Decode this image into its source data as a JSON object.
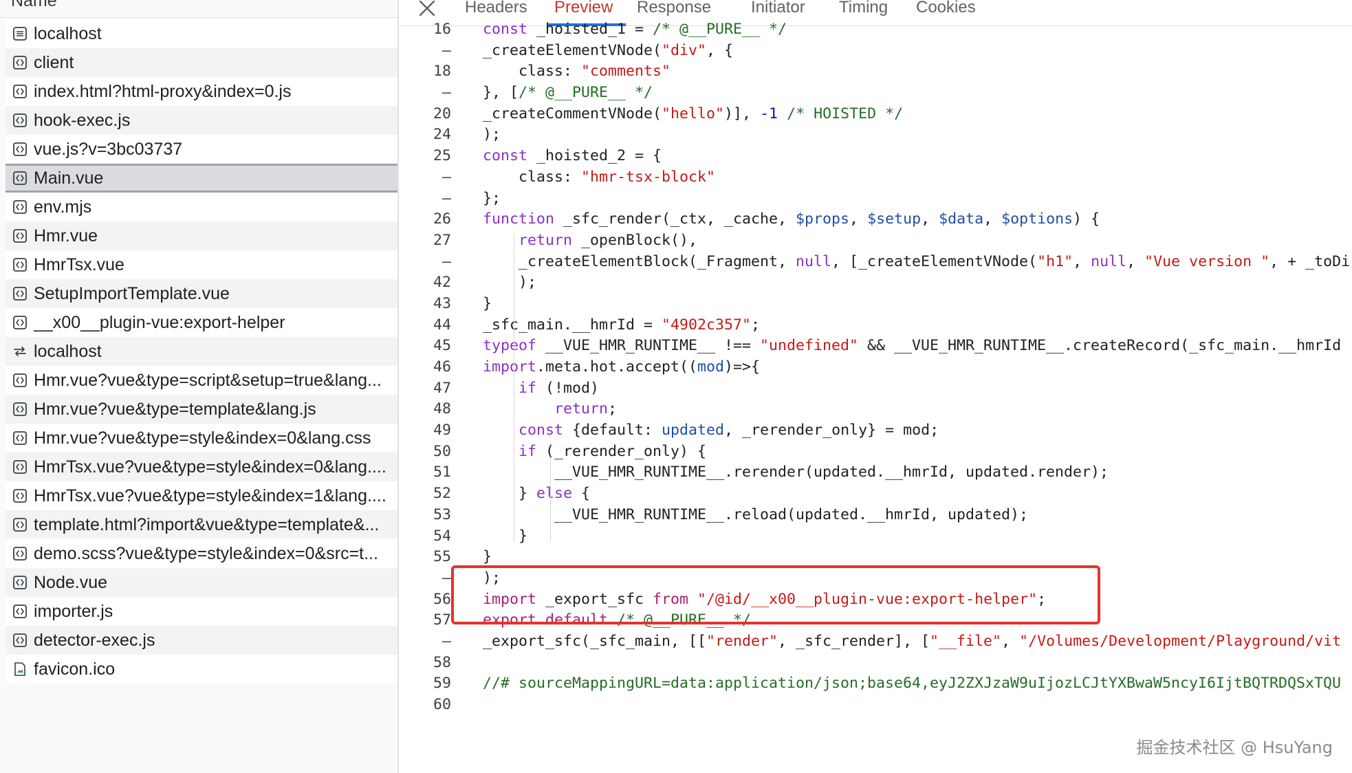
{
  "file_panel": {
    "header": "Name",
    "files": [
      {
        "name": "localhost",
        "icon": "document-icon"
      },
      {
        "name": "client",
        "icon": "script-icon"
      },
      {
        "name": "index.html?html-proxy&index=0.js",
        "icon": "script-icon"
      },
      {
        "name": "hook-exec.js",
        "icon": "script-icon"
      },
      {
        "name": "vue.js?v=3bc03737",
        "icon": "script-icon"
      },
      {
        "name": "Main.vue",
        "icon": "script-icon"
      },
      {
        "name": "env.mjs",
        "icon": "script-icon"
      },
      {
        "name": "Hmr.vue",
        "icon": "script-icon"
      },
      {
        "name": "HmrTsx.vue",
        "icon": "script-icon"
      },
      {
        "name": "SetupImportTemplate.vue",
        "icon": "script-icon"
      },
      {
        "name": "__x00__plugin-vue:export-helper",
        "icon": "script-icon"
      },
      {
        "name": "localhost",
        "icon": "websocket-icon"
      },
      {
        "name": "Hmr.vue?vue&type=script&setup=true&lang...",
        "icon": "script-icon"
      },
      {
        "name": "Hmr.vue?vue&type=template&lang.js",
        "icon": "script-icon"
      },
      {
        "name": "Hmr.vue?vue&type=style&index=0&lang.css",
        "icon": "script-icon"
      },
      {
        "name": "HmrTsx.vue?vue&type=style&index=0&lang....",
        "icon": "script-icon"
      },
      {
        "name": "HmrTsx.vue?vue&type=style&index=1&lang....",
        "icon": "script-icon"
      },
      {
        "name": "template.html?import&vue&type=template&...",
        "icon": "script-icon"
      },
      {
        "name": "demo.scss?vue&type=style&index=0&src=t...",
        "icon": "script-icon"
      },
      {
        "name": "Node.vue",
        "icon": "script-icon"
      },
      {
        "name": "importer.js",
        "icon": "script-icon"
      },
      {
        "name": "detector-exec.js",
        "icon": "script-icon"
      },
      {
        "name": "favicon.ico",
        "icon": "image-file-icon"
      }
    ],
    "selected_index": 5
  },
  "tabs": [
    "Headers",
    "Preview",
    "Response",
    "Initiator",
    "Timing",
    "Cookies"
  ],
  "active_tab": "Preview",
  "code_lines": [
    {
      "num": "16",
      "code": [
        [
          "kw",
          "const "
        ],
        [
          "",
          "_hoisted_1 = "
        ],
        [
          "cm",
          "/* @__PURE__ */"
        ]
      ]
    },
    {
      "num": "–",
      "code": [
        [
          "",
          "_createElementVNode("
        ],
        [
          "str",
          "\"div\""
        ],
        [
          "",
          ", {"
        ]
      ]
    },
    {
      "num": "18",
      "code": [
        [
          "",
          "    class: "
        ],
        [
          "str",
          "\"comments\""
        ]
      ]
    },
    {
      "num": "–",
      "code": [
        [
          "",
          "}, ["
        ],
        [
          "cm",
          "/* @__PURE__ */"
        ]
      ]
    },
    {
      "num": "20",
      "code": [
        [
          "",
          "_createCommentVNode("
        ],
        [
          "str",
          "\"hello\""
        ],
        [
          "",
          ")], "
        ],
        [
          "num",
          "-1"
        ],
        [
          "cm",
          " /* HOISTED */"
        ]
      ]
    },
    {
      "num": "24",
      "code": [
        [
          "",
          ");"
        ]
      ]
    },
    {
      "num": "25",
      "code": [
        [
          "kw",
          "const "
        ],
        [
          "",
          "_hoisted_2 = {"
        ]
      ]
    },
    {
      "num": "–",
      "code": [
        [
          "",
          "    class: "
        ],
        [
          "str",
          "\"hmr-tsx-block\""
        ]
      ]
    },
    {
      "num": "–",
      "code": [
        [
          "",
          "};"
        ]
      ]
    },
    {
      "num": "26",
      "code": [
        [
          "kw",
          "function "
        ],
        [
          "",
          "_sfc_render(_ctx, _cache, "
        ],
        [
          "var",
          "$props"
        ],
        [
          "",
          ", "
        ],
        [
          "var",
          "$setup"
        ],
        [
          "",
          ", "
        ],
        [
          "var",
          "$data"
        ],
        [
          "",
          ", "
        ],
        [
          "var",
          "$options"
        ],
        [
          "",
          ") {"
        ]
      ]
    },
    {
      "num": "27",
      "code": [
        [
          "",
          "    "
        ],
        [
          "kw",
          "return "
        ],
        [
          "",
          "_openBlock(),"
        ]
      ]
    },
    {
      "num": "–",
      "code": [
        [
          "",
          "    _createElementBlock(_Fragment, "
        ],
        [
          "kw",
          "null"
        ],
        [
          "",
          ", [_createElementVNode("
        ],
        [
          "str",
          "\"h1\""
        ],
        [
          "",
          ", "
        ],
        [
          "kw",
          "null"
        ],
        [
          "",
          ", "
        ],
        [
          "str",
          "\"Vue version \""
        ],
        [
          "",
          ", + _toDi"
        ]
      ]
    },
    {
      "num": "42",
      "code": [
        [
          "",
          "    );"
        ]
      ]
    },
    {
      "num": "43",
      "code": [
        [
          "",
          "}"
        ]
      ]
    },
    {
      "num": "44",
      "code": [
        [
          "",
          "_sfc_main.__hmrId = "
        ],
        [
          "str",
          "\"4902c357\""
        ],
        [
          "",
          ";"
        ]
      ]
    },
    {
      "num": "45",
      "code": [
        [
          "kw",
          "typeof "
        ],
        [
          "",
          "__VUE_HMR_RUNTIME__ !== "
        ],
        [
          "str",
          "\"undefined\""
        ],
        [
          "",
          " && __VUE_HMR_RUNTIME__.createRecord(_sfc_main.__hmrId"
        ]
      ]
    },
    {
      "num": "46",
      "code": [
        [
          "kw",
          "import"
        ],
        [
          "",
          ".meta.hot.accept(("
        ],
        [
          "var",
          "mod"
        ],
        [
          "",
          ")=>{"
        ]
      ]
    },
    {
      "num": "47",
      "code": [
        [
          "",
          "    "
        ],
        [
          "kw",
          "if "
        ],
        [
          "",
          "(!mod)"
        ]
      ]
    },
    {
      "num": "48",
      "code": [
        [
          "",
          "        "
        ],
        [
          "kw",
          "return"
        ],
        [
          "",
          ";"
        ]
      ]
    },
    {
      "num": "49",
      "code": [
        [
          "",
          "    "
        ],
        [
          "kw",
          "const "
        ],
        [
          "",
          "{default: "
        ],
        [
          "var",
          "updated"
        ],
        [
          "",
          ", _rerender_only} = mod;"
        ]
      ]
    },
    {
      "num": "50",
      "code": [
        [
          "",
          "    "
        ],
        [
          "kw",
          "if "
        ],
        [
          "",
          "(_rerender_only) {"
        ]
      ]
    },
    {
      "num": "51",
      "code": [
        [
          "",
          "        __VUE_HMR_RUNTIME__.rerender(updated.__hmrId, updated.render);"
        ]
      ]
    },
    {
      "num": "52",
      "code": [
        [
          "",
          "    } "
        ],
        [
          "kw",
          "else "
        ],
        [
          "",
          "{"
        ]
      ]
    },
    {
      "num": "53",
      "code": [
        [
          "",
          "        __VUE_HMR_RUNTIME__.reload(updated.__hmrId, updated);"
        ]
      ]
    },
    {
      "num": "54",
      "code": [
        [
          "",
          "    }"
        ]
      ]
    },
    {
      "num": "55",
      "code": [
        [
          "",
          "}"
        ]
      ]
    },
    {
      "num": "–",
      "code": [
        [
          "",
          ");"
        ]
      ]
    },
    {
      "num": "56",
      "code": [
        [
          "kw2",
          "import "
        ],
        [
          "",
          "_export_sfc "
        ],
        [
          "kw2",
          "from "
        ],
        [
          "str",
          "\"/@id/__x00__plugin-vue:export-helper\""
        ],
        [
          "",
          ";"
        ]
      ]
    },
    {
      "num": "57",
      "code": [
        [
          "kw2",
          "export default "
        ],
        [
          "cm",
          "/* @__PURE__ */"
        ]
      ]
    },
    {
      "num": "–",
      "code": [
        [
          "",
          "_export_sfc(_sfc_main, [["
        ],
        [
          "str",
          "\"render\""
        ],
        [
          "",
          ", _sfc_render], ["
        ],
        [
          "str",
          "\"__file\""
        ],
        [
          "",
          ", "
        ],
        [
          "str",
          "\"/Volumes/Development/Playground/vit"
        ]
      ]
    },
    {
      "num": "58",
      "code": [
        [
          "",
          ""
        ]
      ]
    },
    {
      "num": "59",
      "code": [
        [
          "cm",
          "//# sourceMappingURL=data:application/json;base64,eyJ2ZXJzaW9uIjozLCJtYXBwaW5ncyI6IjtBQTRDQSxTQU"
        ]
      ]
    },
    {
      "num": "60",
      "code": [
        [
          "",
          ""
        ]
      ]
    }
  ],
  "watermark": "掘金技术社区 @ HsuYang",
  "colors": {
    "keyword": "#8b2fc9",
    "string": "#c41a16",
    "comment": "#236e25",
    "highlight_box": "#e5322d",
    "active_tab": "#c0392b"
  }
}
